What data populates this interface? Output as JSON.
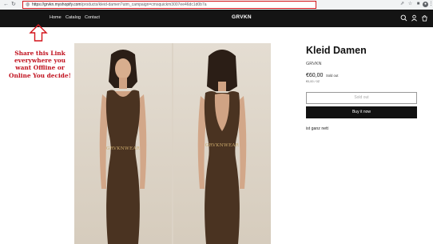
{
  "browser": {
    "url_host": "https://grvkn.myshopify.com",
    "url_path": "/products/kleid-damen?utm_campaign=cmsquickm3007ee46dc1d0b7a",
    "icons": [
      "back-icon",
      "reload-icon",
      "lock-icon",
      "share-icon",
      "star-icon",
      "extension-icon",
      "profile-icon",
      "menu-icon"
    ]
  },
  "header": {
    "nav": [
      "Home",
      "Catalog",
      "Contact"
    ],
    "logo": "GRVKN",
    "icons": [
      "search-icon",
      "account-icon",
      "cart-icon"
    ]
  },
  "promo": {
    "text": "Share this Link everywhere you want Offline or Online You decide!",
    "color": "#c1121f"
  },
  "image": {
    "dress_print": "GRVKNWEAR",
    "dress_color": "#4a3321"
  },
  "product": {
    "title": "Kleid Damen",
    "vendor": "GRVKN",
    "price": "€60,00",
    "badge": "Sold out",
    "unit_price": "€0,00 / 0Z",
    "sold_out_label": "Sold out",
    "buy_label": "Buy it now",
    "description": "ist ganz nett"
  }
}
